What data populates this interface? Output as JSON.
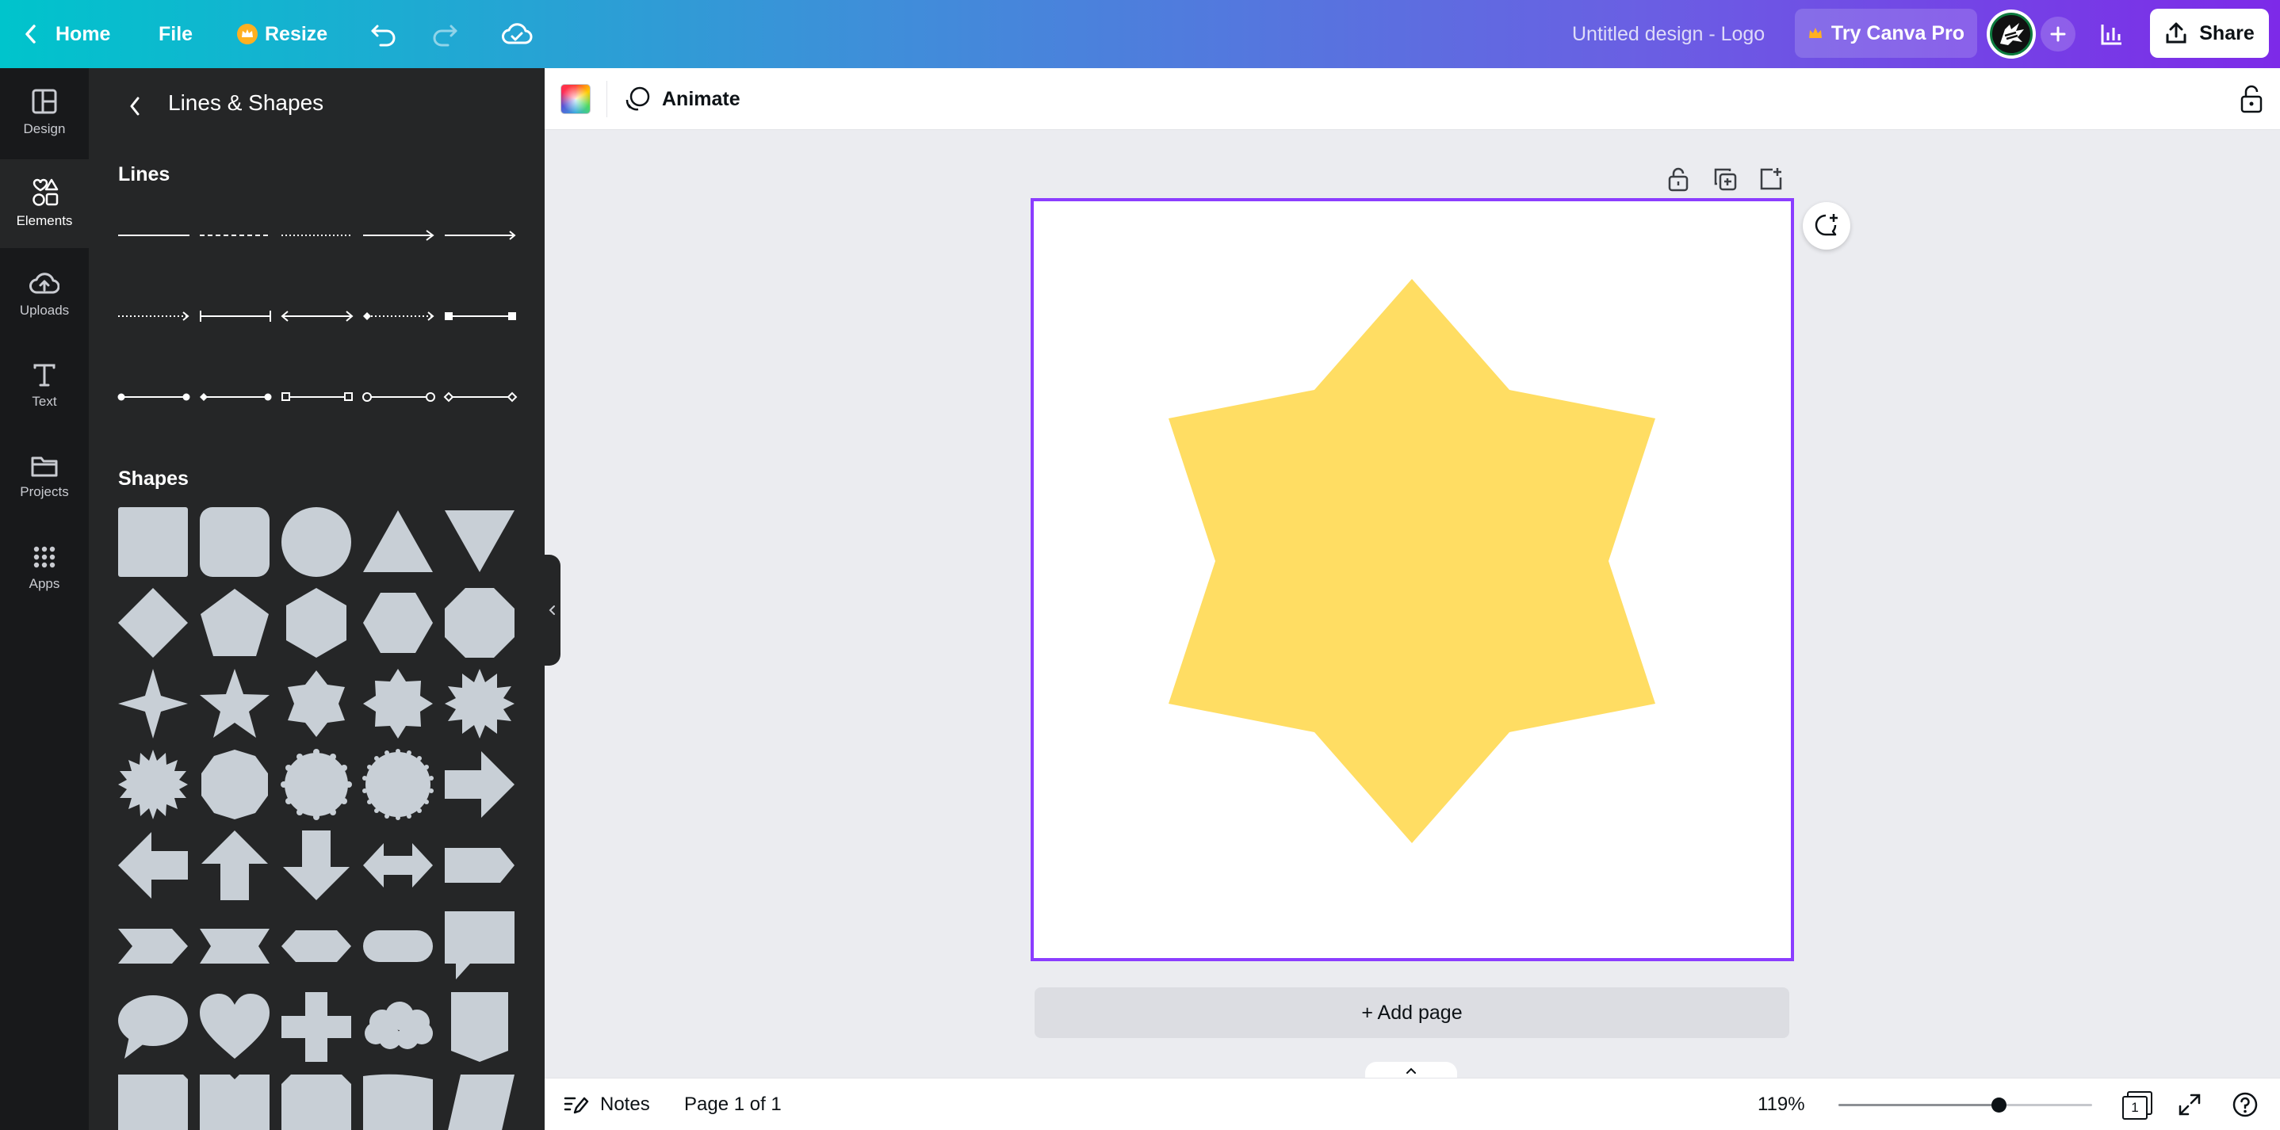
{
  "topbar": {
    "home_label": "Home",
    "file_label": "File",
    "resize_label": "Resize",
    "design_title": "Untitled design - Logo",
    "try_pro_label": "Try Canva Pro",
    "share_label": "Share"
  },
  "rail": {
    "items": [
      {
        "label": "Design",
        "icon": "layout-icon"
      },
      {
        "label": "Elements",
        "icon": "elements-icon"
      },
      {
        "label": "Uploads",
        "icon": "upload-cloud-icon"
      },
      {
        "label": "Text",
        "icon": "text-icon"
      },
      {
        "label": "Projects",
        "icon": "folder-icon"
      },
      {
        "label": "Apps",
        "icon": "apps-grid-icon"
      }
    ]
  },
  "panel": {
    "title": "Lines & Shapes",
    "lines_title": "Lines",
    "shapes_title": "Shapes"
  },
  "ctxbar": {
    "animate_label": "Animate"
  },
  "canvas": {
    "add_page_label": "+ Add page",
    "star_color": "#FFDD63"
  },
  "bottombar": {
    "notes_label": "Notes",
    "page_label": "Page 1 of 1",
    "zoom_label": "119%",
    "zoom_value": 0.63,
    "page_count": "1"
  },
  "colors": {
    "accent": "#8b3dff",
    "shape_fill": "#c8cfd6",
    "rail_bg": "#18191b",
    "panel_bg": "#252627"
  }
}
